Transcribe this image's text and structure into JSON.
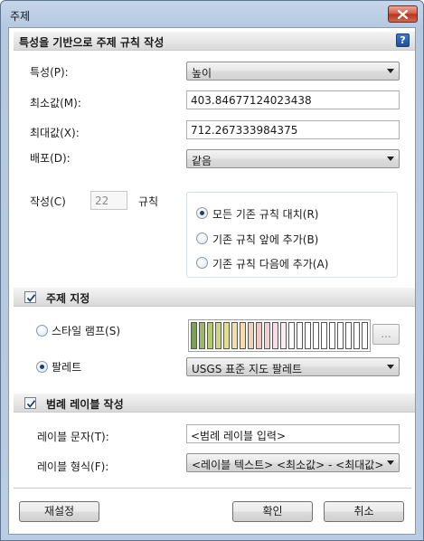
{
  "window": {
    "title": "주제"
  },
  "section1": {
    "title": "특성을 기반으로 주제 규칙 작성",
    "property_label": "특성(P):",
    "property_value": "높이",
    "min_label": "최소값(M):",
    "min_value": "403.84677124023438",
    "max_label": "최대값(X):",
    "max_value": "712.267333984375",
    "dist_label": "배포(D):",
    "dist_value": "같음",
    "create_label": "작성(C)",
    "create_count": "22",
    "rules_label": "규칙",
    "radios": [
      {
        "label": "모든 기존 규칙 대치(R)",
        "checked": true
      },
      {
        "label": "기존 규칙 앞에 추가(B)",
        "checked": false
      },
      {
        "label": "기존 규칙 다음에 추가(A)",
        "checked": false
      }
    ]
  },
  "section2": {
    "title": "주제 지정",
    "checked": true,
    "ramp_label": "스타일 램프(S)",
    "ramp_checked": false,
    "ramp_more": "...",
    "palette_label": "팔레트",
    "palette_checked": true,
    "palette_value": "USGS 표준 지도 팔레트",
    "swatches": [
      "#7ca05a",
      "#9bb865",
      "#b6c96f",
      "#cfd77d",
      "#e2e08f",
      "#eee3a0",
      "#f4ddb0",
      "#f2d1b9",
      "#efc8c3",
      "#f1cfd3",
      "#f5dde3",
      "#faeef2",
      "#ffffff",
      "#ffffff",
      "#ffffff",
      "#ffffff",
      "#ffffff",
      "#ffffff",
      "#ffffff",
      "#ffffff",
      "#ffffff",
      "#ffffff"
    ]
  },
  "section3": {
    "title": "범례 레이블 작성",
    "checked": true,
    "text_label": "레이블 문자(T):",
    "text_value": "<범례 레이블 입력>",
    "format_label": "레이블 형식(F):",
    "format_value": "<레이블 텍스트> <최소값> - <최대값>"
  },
  "buttons": {
    "reset": "재설정",
    "ok": "확인",
    "cancel": "취소"
  },
  "icons": {
    "close": "close-icon",
    "help": "help-icon",
    "check": "check-icon"
  },
  "colors": {
    "title_bar": "#b9cce3",
    "header_band": "#d9d9d9",
    "close_button": "#c8462e"
  }
}
